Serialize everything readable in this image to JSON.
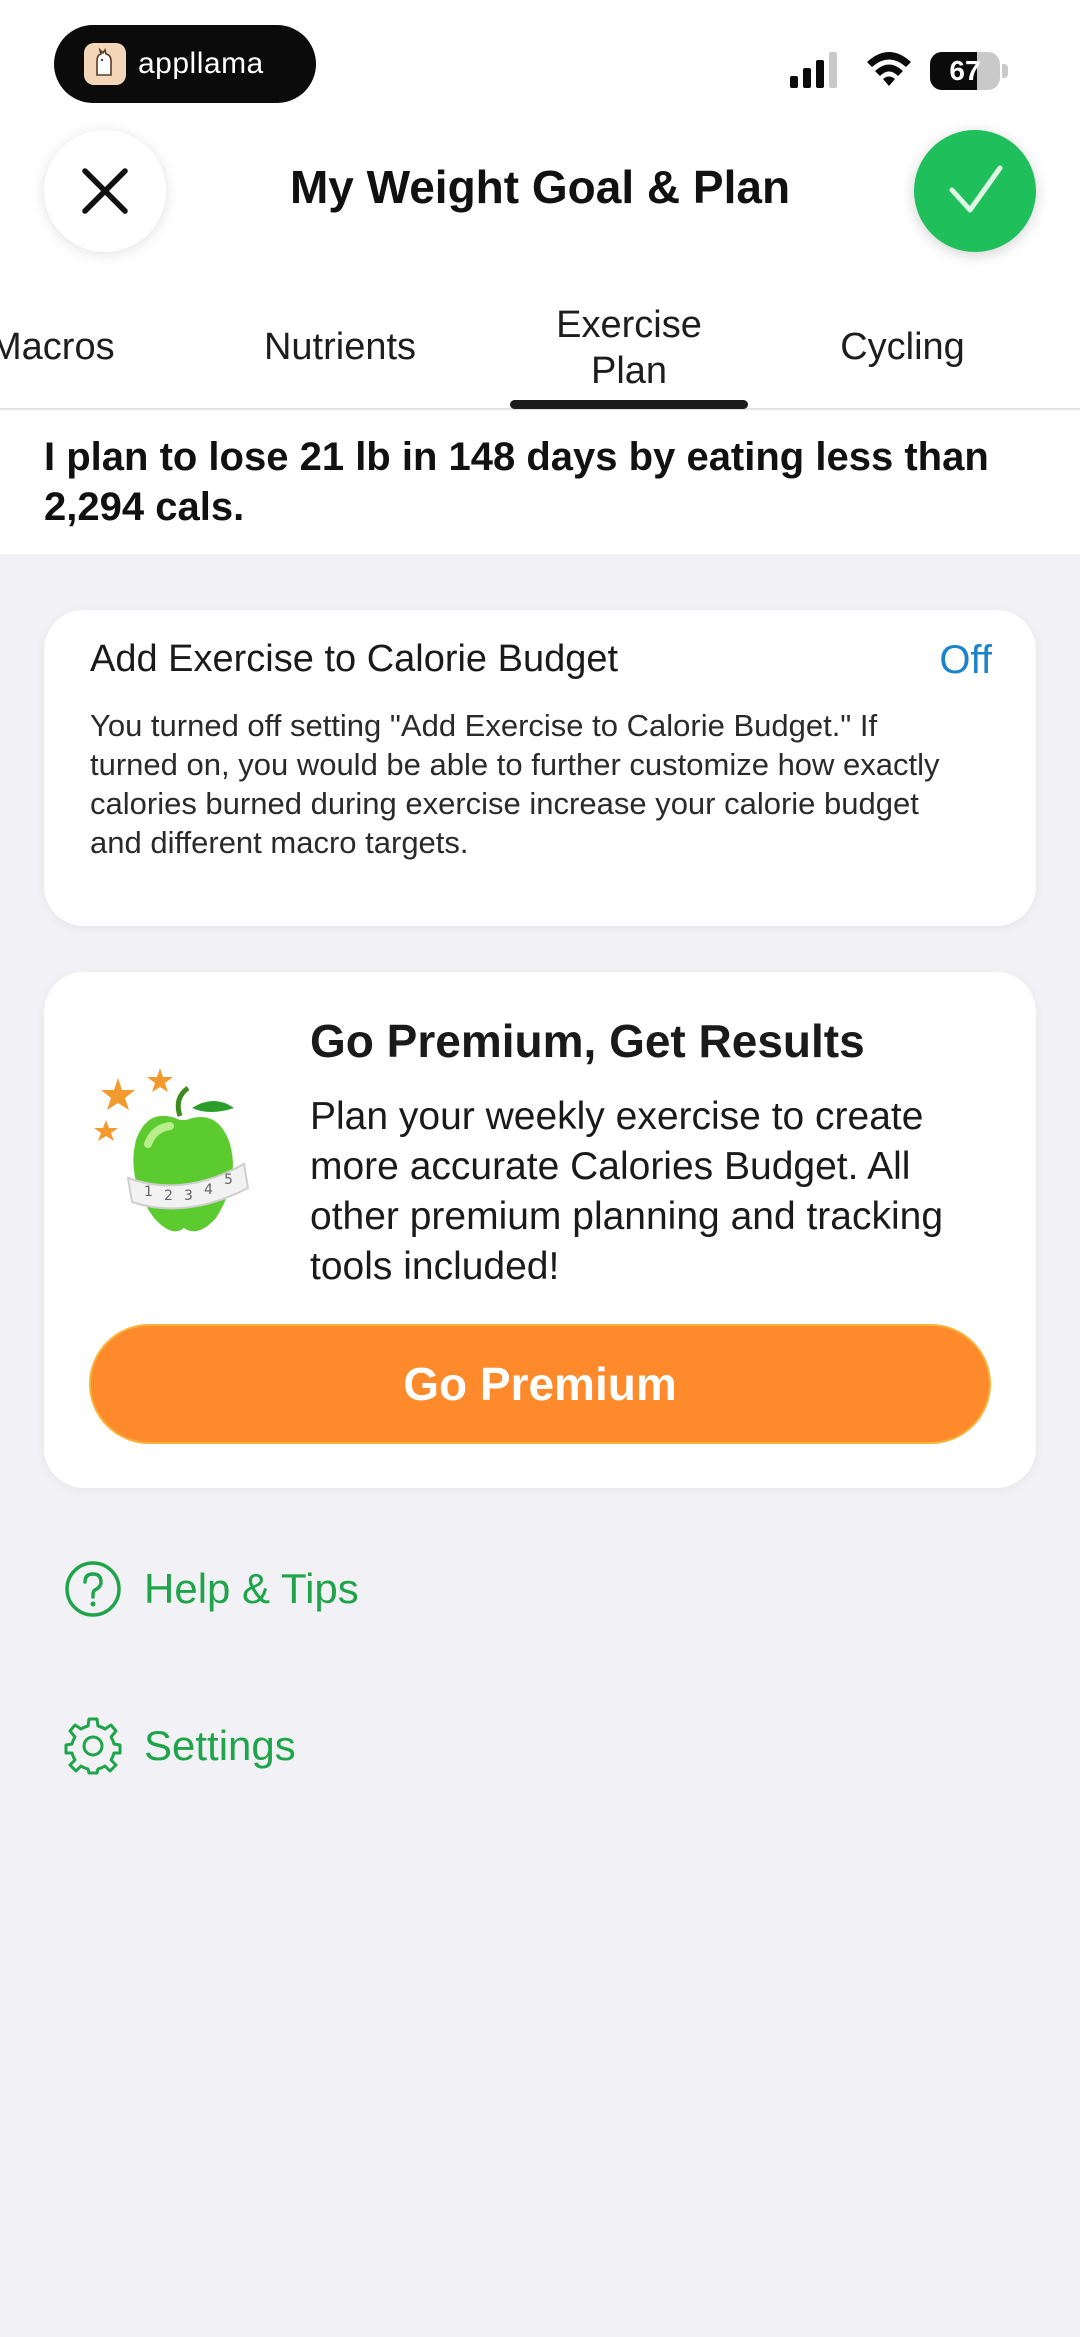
{
  "status_bar": {
    "brand": "appllama",
    "battery_level": "67",
    "battery_fraction": 0.67
  },
  "header": {
    "title": "My Weight Goal & Plan",
    "close_icon": "close-icon",
    "confirm_icon": "check-icon"
  },
  "tabs": [
    {
      "label": "Macros"
    },
    {
      "label": "Nutrients"
    },
    {
      "label": "Exercise\nPlan",
      "active": true
    },
    {
      "label": "Cycling"
    }
  ],
  "plan_summary": "I plan to lose 21 lb in 148 days by eating less than 2,294 cals.",
  "exercise_card": {
    "title": "Add Exercise to Calorie Budget",
    "toggle_value": "Off",
    "description": "You turned off setting \"Add Exercise to Calorie Budget.\" If turned on, you would be able to further customize how exactly calories burned during exercise increase your calorie budget and different macro targets."
  },
  "premium_card": {
    "title": "Go Premium, Get Results",
    "description": "Plan your weekly exercise to create more accurate Calories Budget. All other premium planning and tracking tools included!",
    "button_label": "Go Premium",
    "illustration": "apple-measuring-tape-icon"
  },
  "links": {
    "help": {
      "label": "Help & Tips",
      "icon": "question-circle-icon"
    },
    "settings": {
      "label": "Settings",
      "icon": "gear-icon"
    }
  },
  "colors": {
    "accent_green": "#1fbf5b",
    "link_green": "#1fa44a",
    "toggle_blue": "#1b84c9",
    "premium_orange": "#ff8a2b"
  }
}
